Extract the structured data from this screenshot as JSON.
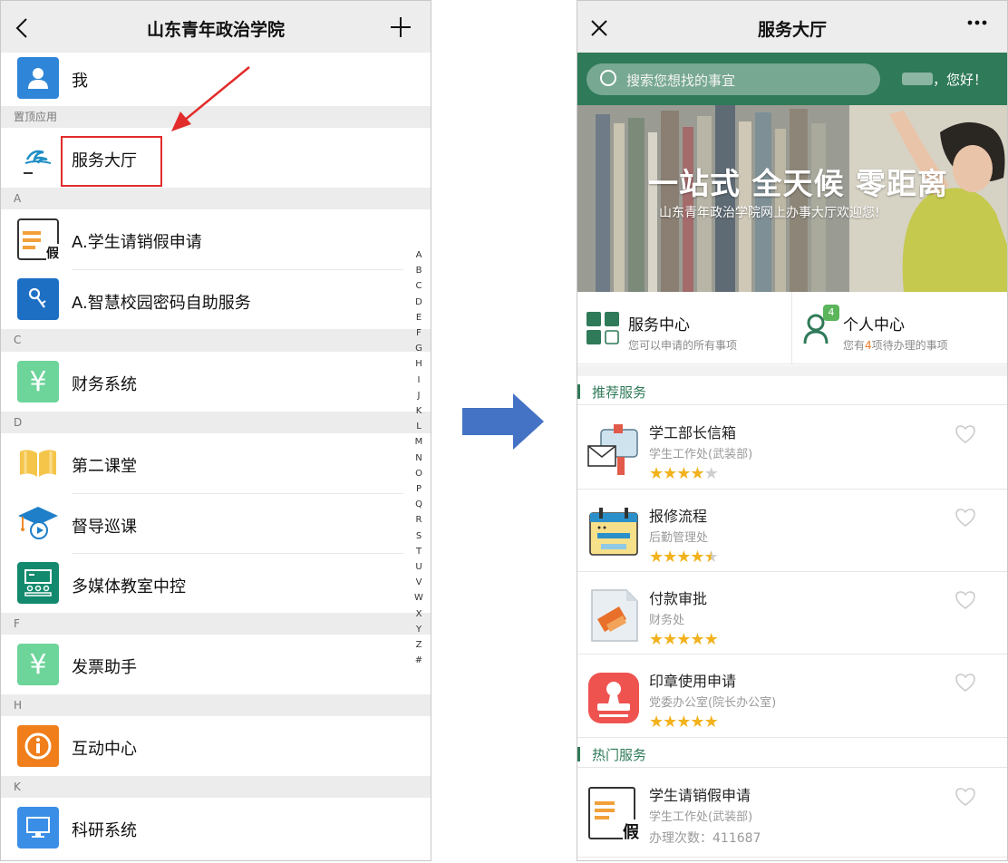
{
  "left": {
    "header": {
      "title": "山东青年政治学院"
    },
    "me": {
      "label": "我"
    },
    "pinned_section": "置顶应用",
    "pinned_item": {
      "label": "服务大厅"
    },
    "sections": [
      {
        "letter": "A",
        "items": [
          "A.学生请销假申请",
          "A.智慧校园密码自助服务"
        ]
      },
      {
        "letter": "C",
        "items": [
          "财务系统"
        ]
      },
      {
        "letter": "D",
        "items": [
          "第二课堂",
          "督导巡课",
          "多媒体教室中控"
        ]
      },
      {
        "letter": "F",
        "items": [
          "发票助手"
        ]
      },
      {
        "letter": "H",
        "items": [
          "互动中心"
        ]
      },
      {
        "letter": "K",
        "items": [
          "科研系统"
        ]
      }
    ],
    "index_letters": [
      "A",
      "B",
      "C",
      "D",
      "E",
      "F",
      "G",
      "H",
      "I",
      "J",
      "K",
      "L",
      "M",
      "N",
      "O",
      "P",
      "Q",
      "R",
      "S",
      "T",
      "U",
      "V",
      "W",
      "X",
      "Y",
      "Z",
      "#"
    ],
    "icon_texts": {
      "leave": "假",
      "finance": "¥",
      "invoice": "¥"
    }
  },
  "right": {
    "header": {
      "title": "服务大厅"
    },
    "search": {
      "placeholder": "搜索您想找的事宜"
    },
    "greeting": "，您好！",
    "banner": {
      "slogan": "一站式 全天候 零距离",
      "subtitle": "山东青年政治学院网上办事大厅欢迎您!"
    },
    "quick": [
      {
        "title": "服务中心",
        "desc": "您可以申请的所有事项"
      },
      {
        "title": "个人中心",
        "desc_pre": "您有",
        "count": "4",
        "desc_post": "项待办理的事项",
        "badge": "4"
      }
    ],
    "recommended": {
      "title": "推荐服务",
      "items": [
        {
          "name": "学工部长信箱",
          "dept": "学生工作处(武装部)",
          "rating": 4
        },
        {
          "name": "报修流程",
          "dept": "后勤管理处",
          "rating": 4.5
        },
        {
          "name": "付款审批",
          "dept": "财务处",
          "rating": 5
        },
        {
          "name": "印章使用申请",
          "dept": "党委办公室(院长办公室)",
          "rating": 5
        }
      ]
    },
    "hot": {
      "title": "热门服务",
      "items": [
        {
          "name": "学生请销假申请",
          "dept": "学生工作处(武装部)",
          "count_label": "办理次数：",
          "count": "411687",
          "icon_text": "假"
        }
      ]
    },
    "colors": {
      "theme_green": "#2f7a58",
      "star": "#f2b21c",
      "red_annotation": "#e22b2b",
      "arrow_blue": "#4472c4"
    }
  }
}
